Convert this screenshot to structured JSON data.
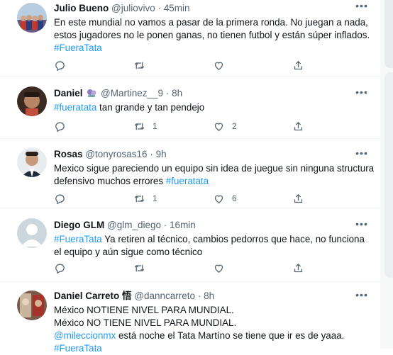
{
  "tweets": [
    {
      "name": "Julio Bueno",
      "handle": "@juliovivo",
      "dot": "·",
      "time": "45min",
      "lines": [
        [
          {
            "t": "En este mundial no vamos a pasar de la primera ronda. No juegan a nada,"
          }
        ],
        [
          {
            "t": "estos jugadores no le ponen ganas, no tienen futbol y están súper inflados."
          }
        ],
        [
          {
            "t": "#FueraTata",
            "tag": true
          }
        ]
      ],
      "reply_count": "",
      "retweet_count": "",
      "like_count": ""
    },
    {
      "name": "Daniel",
      "handle": "@Martinez__9",
      "dot": "·",
      "time": "8h",
      "lines": [
        [
          {
            "t": "#fueratata",
            "tag": true
          },
          {
            "t": " tan grande y tan pendejo"
          }
        ]
      ],
      "reply_count": "",
      "retweet_count": "1",
      "like_count": "2"
    },
    {
      "name": "Rosas",
      "handle": "@tonyrosas16",
      "dot": "·",
      "time": "9h",
      "lines": [
        [
          {
            "t": "Mexico sigue pareciendo un equipo sin idea de juegue sin ninguna structura"
          }
        ],
        [
          {
            "t": "defensivo muchos errores "
          },
          {
            "t": "#fueratata",
            "tag": true
          }
        ]
      ],
      "reply_count": "",
      "retweet_count": "1",
      "like_count": "6"
    },
    {
      "name": "Diego GLM",
      "handle": "@glm_diego",
      "dot": "·",
      "time": "16min",
      "lines": [
        [
          {
            "t": "#FueraTata",
            "tag": true
          },
          {
            "t": " Ya retiren al técnico, cambios pedorros que hace, no funciona"
          }
        ],
        [
          {
            "t": "el equipo y aún sigue como técnico"
          }
        ]
      ],
      "reply_count": "",
      "retweet_count": "",
      "like_count": ""
    },
    {
      "name": "Daniel Carreto 悟",
      "handle": "@danncarreto",
      "dot": "·",
      "time": "8h",
      "lines": [
        [
          {
            "t": "México NOTIENE NIVEL PARA MUNDIAL."
          }
        ],
        [
          {
            "t": "México NO TIENE NIVEL PARA MUNDIAL."
          }
        ],
        [
          {
            "t": "@mileccionmx",
            "tag": true
          },
          {
            "t": " está noche el Tata  Martíno se tiene que ir es de yaaa."
          }
        ],
        [
          {
            "t": "#FueraTata",
            "tag": true
          }
        ]
      ],
      "reply_count": "",
      "retweet_count": "",
      "like_count": ""
    }
  ],
  "more_icon": "more-horizontal-icon",
  "colors": {
    "link": "#1d9bf0",
    "muted": "#536471",
    "text": "#0f1419",
    "divider": "#eff3f4"
  }
}
